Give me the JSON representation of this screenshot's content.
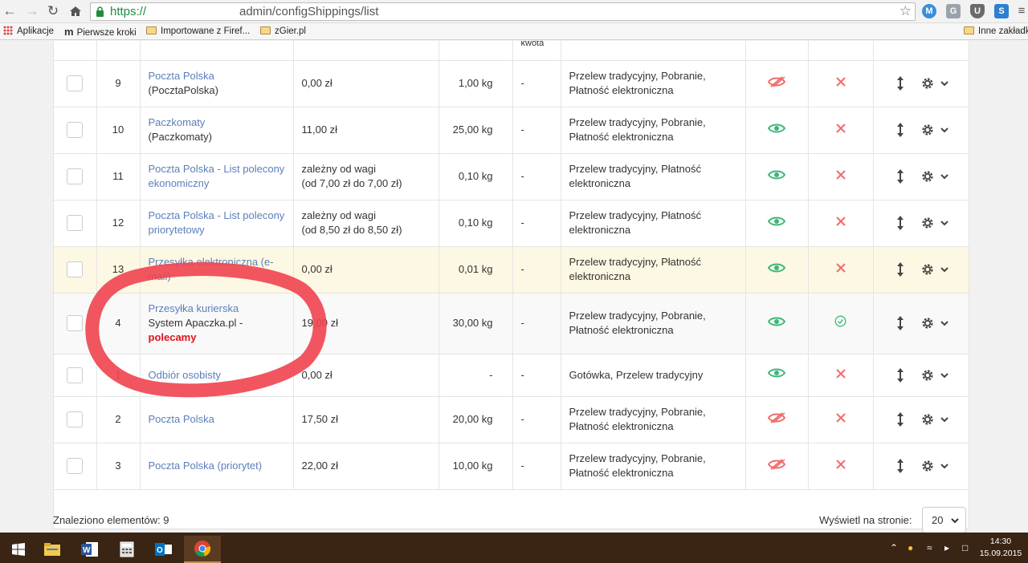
{
  "browser": {
    "url_scheme": "https://",
    "url_path": "admin/configShippings/list",
    "bookmarks": [
      "Aplikacje",
      "Pierwsze kroki",
      "Importowane z Firef...",
      "zGier.pl",
      "Inne zakładk"
    ]
  },
  "table": {
    "header_fragment": "kwota",
    "rows": [
      {
        "id": "9",
        "name": "Poczta Polska",
        "subname": "(PocztaPolska)",
        "price": "0,00 zł",
        "price2": "",
        "weight": "1,00 kg",
        "amount": "-",
        "payments": "Przelew tradycyjny, Pobranie, Płatność elektroniczna",
        "visible": false,
        "default": false
      },
      {
        "id": "10",
        "name": "Paczkomaty",
        "subname": "(Paczkomaty)",
        "price": "11,00 zł",
        "price2": "",
        "weight": "25,00 kg",
        "amount": "-",
        "payments": "Przelew tradycyjny, Pobranie, Płatność elektroniczna",
        "visible": true,
        "default": false
      },
      {
        "id": "11",
        "name": "Poczta Polska - List polecony ekonomiczny",
        "subname": "",
        "price": "zależny od wagi",
        "price2": "(od 7,00 zł do 7,00 zł)",
        "weight": "0,10 kg",
        "amount": "-",
        "payments": "Przelew tradycyjny, Płatność elektroniczna",
        "visible": true,
        "default": false
      },
      {
        "id": "12",
        "name": "Poczta Polska - List polecony priorytetowy",
        "subname": "",
        "price": "zależny od wagi",
        "price2": "(od 8,50 zł do 8,50 zł)",
        "weight": "0,10 kg",
        "amount": "-",
        "payments": "Przelew tradycyjny, Płatność elektroniczna",
        "visible": true,
        "default": false
      },
      {
        "id": "13",
        "name": "Przesyłka elektroniczna (e-mail)",
        "subname": "",
        "price": "0,00 zł",
        "price2": "",
        "weight": "0,01 kg",
        "amount": "-",
        "payments": "Przelew tradycyjny, Płatność elektroniczna",
        "visible": true,
        "default": false
      },
      {
        "id": "4",
        "name": "Przesyłka kurierska",
        "subname": "System Apaczka.pl -",
        "subname_strong": "polecamy",
        "price": "19,00 zł",
        "price2": "",
        "weight": "30,00 kg",
        "amount": "-",
        "payments": "Przelew tradycyjny, Pobranie, Płatność elektroniczna",
        "visible": true,
        "default": true
      },
      {
        "id": "1",
        "name": "Odbiór osobisty",
        "subname": "",
        "price": "0,00 zł",
        "price2": "",
        "weight": "-",
        "amount": "-",
        "payments": "Gotówka, Przelew tradycyjny",
        "visible": true,
        "default": false
      },
      {
        "id": "2",
        "name": "Poczta Polska",
        "subname": "",
        "price": "17,50 zł",
        "price2": "",
        "weight": "20,00 kg",
        "amount": "-",
        "payments": "Przelew tradycyjny, Pobranie, Płatność elektroniczna",
        "visible": false,
        "default": false
      },
      {
        "id": "3",
        "name": "Poczta Polska (priorytet)",
        "subname": "",
        "price": "22,00 zł",
        "price2": "",
        "weight": "10,00 kg",
        "amount": "-",
        "payments": "Przelew tradycyjny, Pobranie, Płatność elektroniczna",
        "visible": false,
        "default": false
      }
    ]
  },
  "footer": {
    "count_label": "Znaleziono elementów: 9",
    "per_page_label": "Wyświetl na stronie:",
    "per_page_value": "20"
  },
  "taskbar": {
    "time": "14:30",
    "date": "15.09.2015"
  },
  "colors": {
    "link": "#5b7fba",
    "visible_icon": "#3cb879",
    "hidden_icon": "#f06b6b",
    "annotation": "#f0434f",
    "highlight_row": "#fdf8e3"
  }
}
